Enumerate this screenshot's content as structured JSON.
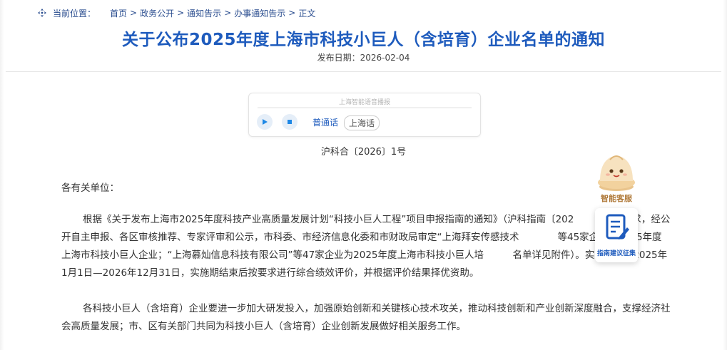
{
  "breadcrumb": {
    "label": "当前位置：",
    "items": [
      "首页",
      "政务公开",
      "通知告示",
      "办事通知告示",
      "正文"
    ],
    "separator": ">"
  },
  "article": {
    "title": "关于公布2025年度上海市科技小巨人（含培育）企业名单的通知",
    "publish_date": "发布日期：2026-02-04",
    "doc_number": "沪科合〔2026〕1号",
    "salutation": "各有关单位：",
    "paragraphs": [
      "根据《关于发布上海市2025年度科技产业高质量发展计划“科技小巨人工程”项目申报指南的通知》（沪科指南〔202　　　　　要求，经公开自主申报、各区审核推荐、专家评审和公示，市科委、市经济信息化委和市财政局审定“上海拜安传感技术　　　　等45家企业为2025年度上海市科技小巨人企业；“上海慕灿信息科技有限公司”等47家企业为2025年度上海市科技小巨人培　　　名单详见附件）。实施周期：2025年1月1日—2026年12月31日，实施期结束后按要求进行综合绩效评价，并根据评价结果择优资助。",
      "各科技小巨人（含培育）企业要进一步加大研发投入，加强原始创新和关键核心技术攻关，推动科技创新和产业创新深度融合，支撑经济社会高质量发展；市、区有关部门共同为科技小巨人（含培育）企业创新发展做好相关服务工作。"
    ]
  },
  "audio": {
    "caption": "上海智能语音播报",
    "languages": [
      "普通话",
      "上海话"
    ],
    "progress": 0
  },
  "widgets": {
    "customer_service": "智能客服",
    "guide_feedback": "指南建议征集"
  },
  "colors": {
    "title": "#1e5bbd",
    "link": "#2a4d8f",
    "accent": "#1e5bbd"
  }
}
